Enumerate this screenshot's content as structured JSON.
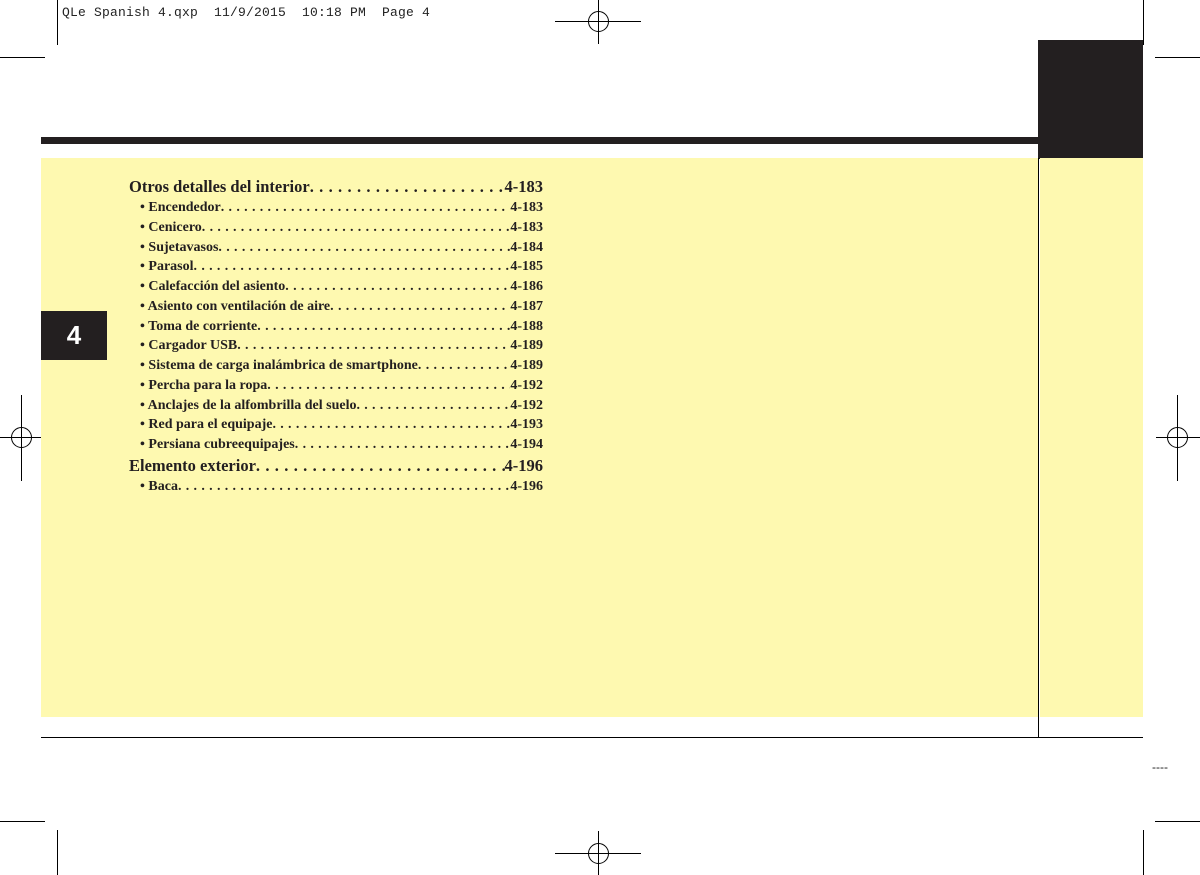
{
  "header": {
    "slug": "QLe Spanish 4.qxp  11/9/2015  10:18 PM  Page 4"
  },
  "chapter_tab": "4",
  "toc": [
    {
      "type": "section",
      "label": "Otros detalles del interior",
      "page": "4-183"
    },
    {
      "type": "sub",
      "label": "• Encendedor",
      "page": "4-183"
    },
    {
      "type": "sub",
      "label": "• Cenicero",
      "page": "4-183"
    },
    {
      "type": "sub",
      "label": "• Sujetavasos",
      "page": "4-184"
    },
    {
      "type": "sub",
      "label": "• Parasol",
      "page": "4-185"
    },
    {
      "type": "sub",
      "label": "• Calefacción del asiento",
      "page": "4-186"
    },
    {
      "type": "sub",
      "label": "• Asiento con ventilación de aire",
      "page": "4-187"
    },
    {
      "type": "sub",
      "label": "• Toma de corriente",
      "page": "4-188"
    },
    {
      "type": "sub",
      "label": "• Cargador USB",
      "page": "4-189"
    },
    {
      "type": "sub",
      "label": "• Sistema de carga inalámbrica de smartphone",
      "page": "4-189"
    },
    {
      "type": "sub",
      "label": "• Percha para la ropa",
      "page": "4-192"
    },
    {
      "type": "sub",
      "label": "• Anclajes de la alfombrilla del suelo",
      "page": "4-192"
    },
    {
      "type": "sub",
      "label": "• Red para el equipaje",
      "page": "4-193"
    },
    {
      "type": "sub",
      "label": "• Persiana cubreequipajes",
      "page": "4-194"
    },
    {
      "type": "section",
      "label": "Elemento exterior",
      "page": "4-196"
    },
    {
      "type": "sub",
      "label": "• Baca",
      "page": "4-196"
    }
  ],
  "footer": {
    "page_marker": "----"
  },
  "colors": {
    "panel": "#fef9b0",
    "dark": "#231f20"
  }
}
